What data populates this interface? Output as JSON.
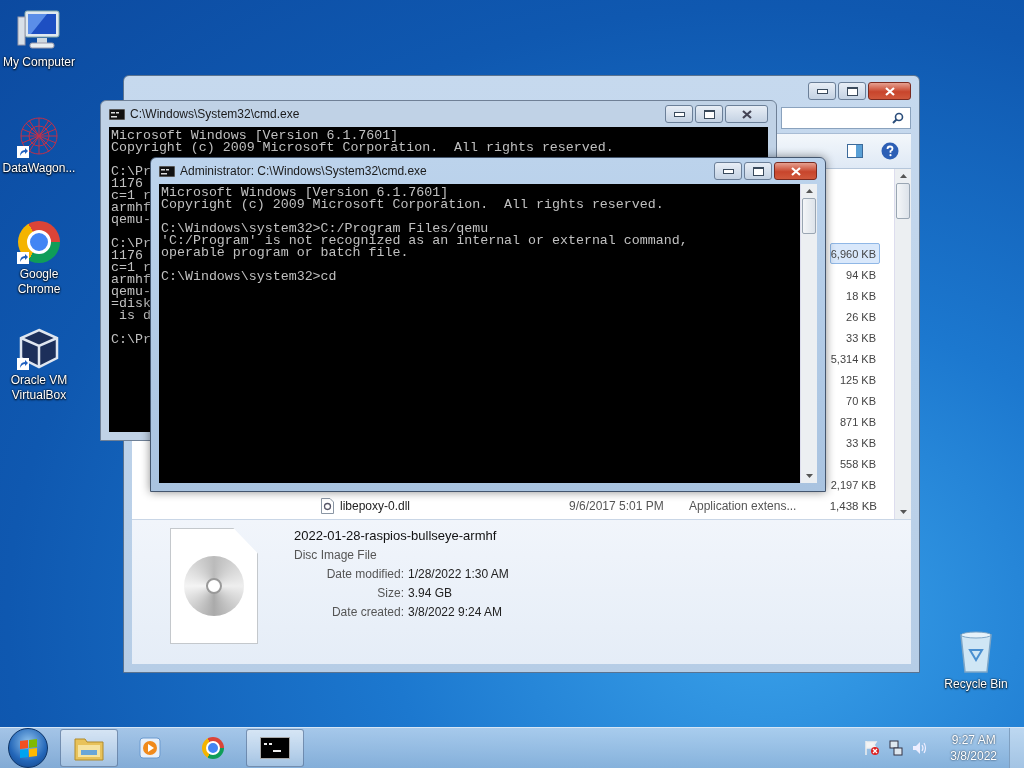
{
  "desktop_icons": [
    {
      "label": "My Computer",
      "kind": "computer",
      "shortcut": false
    },
    {
      "label": "DataWagon...",
      "kind": "network",
      "shortcut": true
    },
    {
      "label": "Google Chrome",
      "kind": "chrome",
      "shortcut": true
    },
    {
      "label": "Oracle VM VirtualBox",
      "kind": "virtualbox",
      "shortcut": true
    }
  ],
  "recycle_bin": {
    "label": "Recycle Bin"
  },
  "explorer": {
    "files": [
      {
        "size": "6,960 KB",
        "selected": true
      },
      {
        "size": "94 KB",
        "selected": false
      },
      {
        "size": "18 KB",
        "selected": false
      },
      {
        "size": "26 KB",
        "selected": false
      },
      {
        "size": "33 KB",
        "selected": false
      },
      {
        "size": "5,314 KB",
        "selected": false
      },
      {
        "size": "125 KB",
        "selected": false
      },
      {
        "size": "70 KB",
        "selected": false
      },
      {
        "size": "871 KB",
        "selected": false
      },
      {
        "size": "33 KB",
        "selected": false
      },
      {
        "size": "558 KB",
        "selected": false
      },
      {
        "size": "2,197 KB",
        "selected": false
      },
      {
        "name": "libepoxy-0.dll",
        "date_modified": "9/6/2017 5:01 PM",
        "type": "Application extens...",
        "size": "1,438 KB",
        "selected": false
      }
    ],
    "details": {
      "name": "2022-01-28-raspios-bullseye-armhf",
      "type": "Disc Image File",
      "properties": [
        {
          "label": "Date modified:",
          "value": "1/28/2022 1:30 AM"
        },
        {
          "label": "Size:",
          "value": "3.94 GB"
        },
        {
          "label": "Date created:",
          "value": "3/8/2022 9:24 AM"
        }
      ]
    }
  },
  "cmd_windows": [
    {
      "title": "C:\\Windows\\System32\\cmd.exe",
      "active": false,
      "blocks": [
        [
          "Microsoft Windows [Version 6.1.7601]",
          "Copyright (c) 2009 Microsoft Corporation.  All rights reserved."
        ],
        [
          "C:\\Pr",
          "1176",
          "c=1 r",
          "armhf",
          "qemu-"
        ],
        [
          "C:\\Pr",
          "1176",
          "c=1 r",
          "armhf",
          "qemu-",
          "=disk",
          " is d"
        ],
        [
          "C:\\Pr"
        ]
      ]
    },
    {
      "title": "Administrator: C:\\Windows\\System32\\cmd.exe",
      "active": true,
      "blocks": [
        [
          "Microsoft Windows [Version 6.1.7601]",
          "Copyright (c) 2009 Microsoft Corporation.  All rights reserved."
        ],
        [
          "C:\\Windows\\system32>C:/Program Files/qemu",
          "'C:/Program' is not recognized as an internal or external command,",
          "operable program or batch file."
        ],
        [
          "C:\\Windows\\system32>cd"
        ]
      ]
    }
  ],
  "taskbar": {
    "items": [
      {
        "kind": "explorer",
        "running": true
      },
      {
        "kind": "media",
        "running": false
      },
      {
        "kind": "chrome",
        "running": false
      },
      {
        "kind": "cmd",
        "running": true
      }
    ],
    "clock": {
      "time": "9:27 AM",
      "date": "3/8/2022"
    }
  }
}
